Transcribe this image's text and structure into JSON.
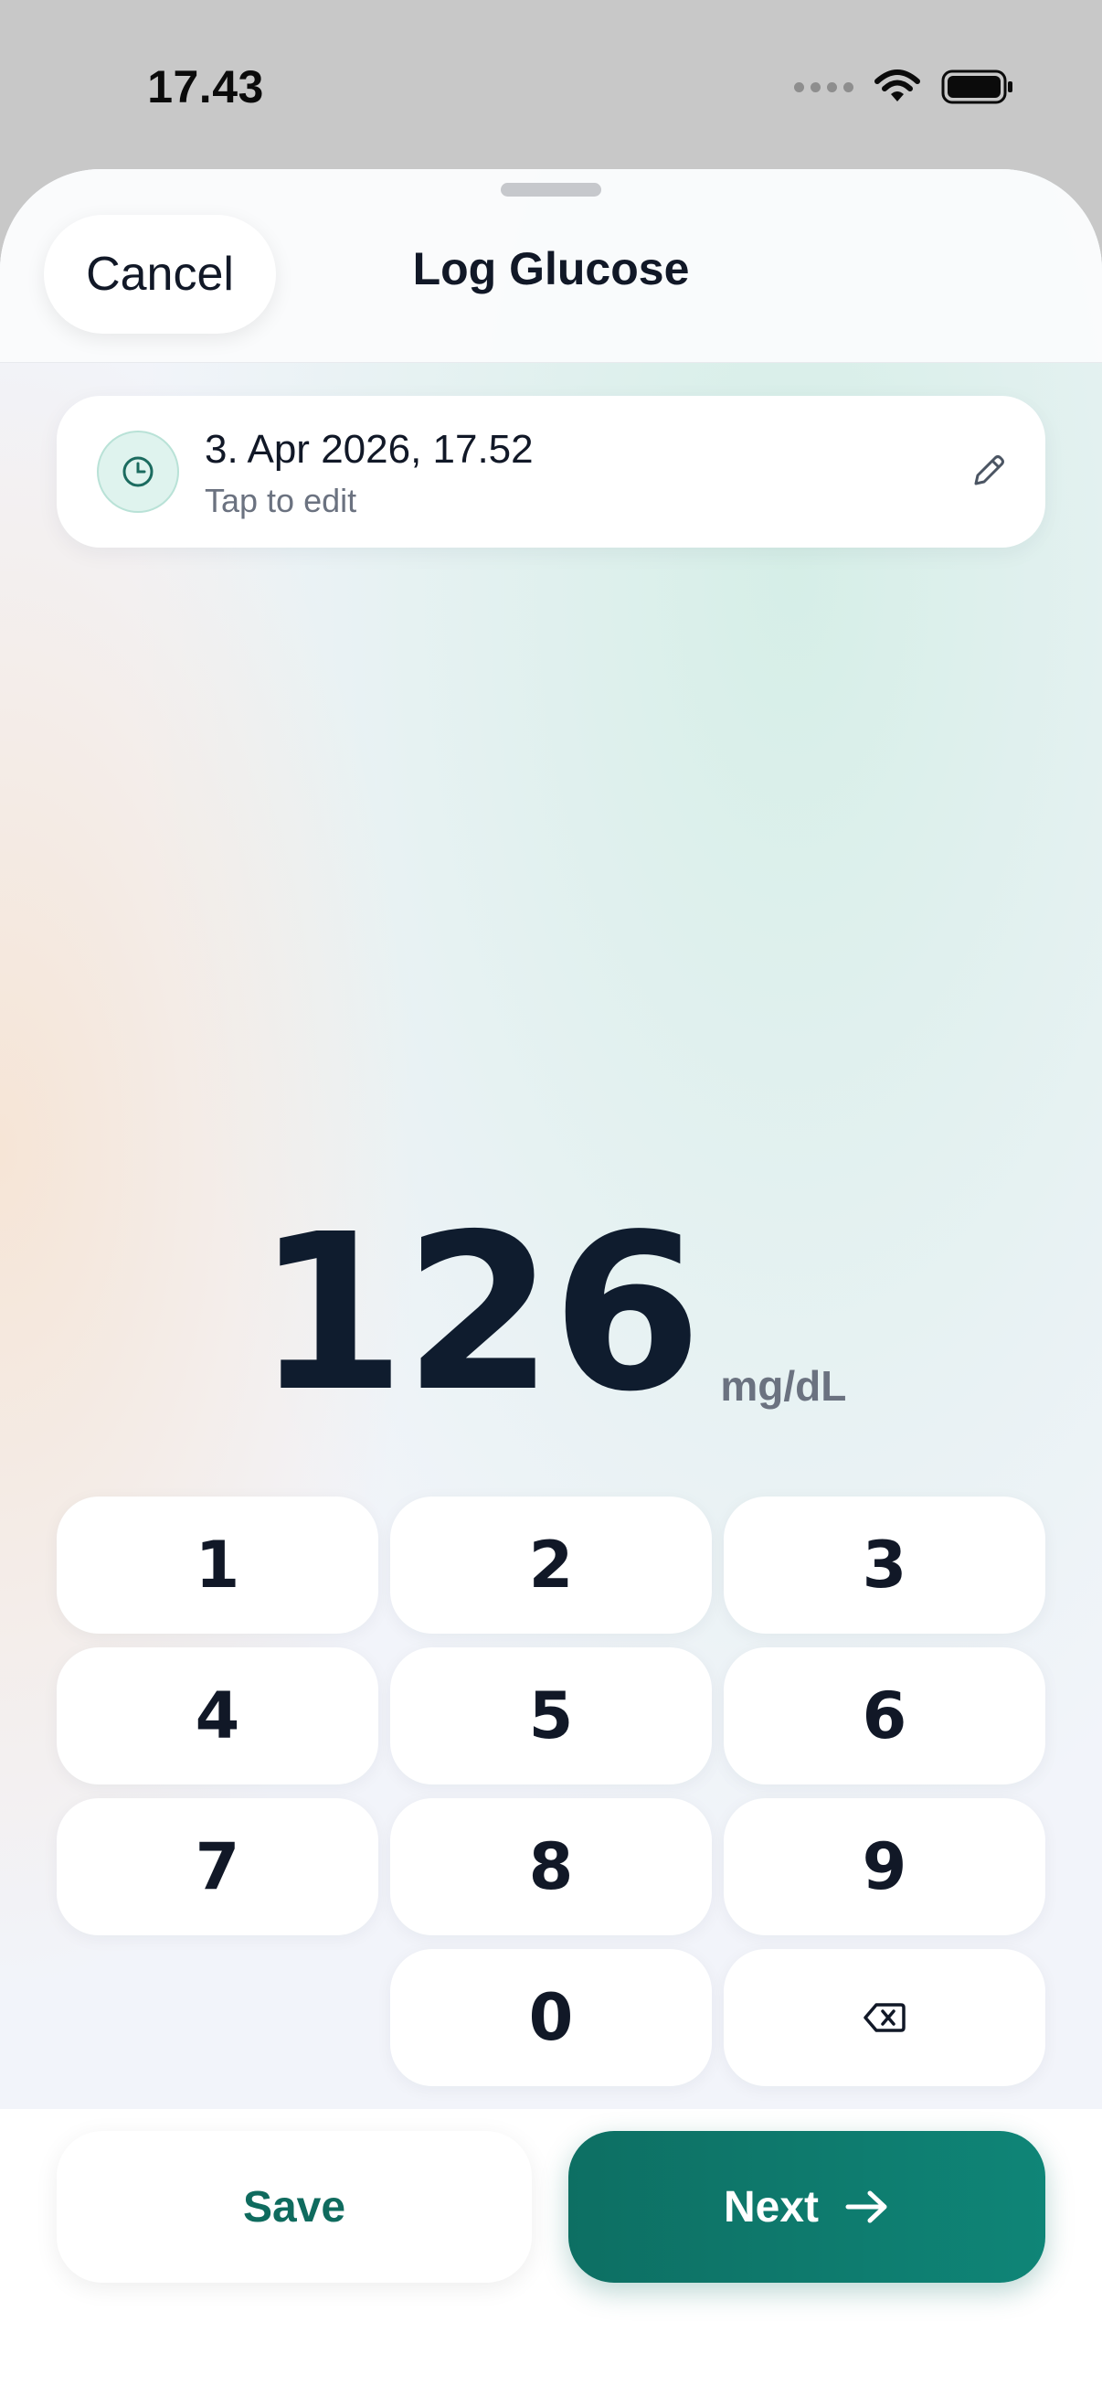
{
  "status_bar": {
    "time": "17.43",
    "icons": [
      "cellular-signal-icon",
      "wifi-icon",
      "battery-icon"
    ]
  },
  "header": {
    "cancel_label": "Cancel",
    "title": "Log Glucose"
  },
  "date_card": {
    "datetime": "3. Apr 2026, 17.52",
    "hint": "Tap to edit",
    "icons": [
      "clock-icon",
      "pencil-icon"
    ]
  },
  "reading": {
    "value": "126",
    "unit": "mg/dL"
  },
  "keypad": {
    "keys": [
      "1",
      "2",
      "3",
      "4",
      "5",
      "6",
      "7",
      "8",
      "9",
      "0"
    ],
    "backspace_icon": "backspace-icon"
  },
  "footer": {
    "save_label": "Save",
    "next_label": "Next",
    "next_icon": "arrow-right-icon"
  },
  "colors": {
    "accent": "#0f7a6d",
    "text_primary": "#111827",
    "text_secondary": "#6b7280"
  }
}
